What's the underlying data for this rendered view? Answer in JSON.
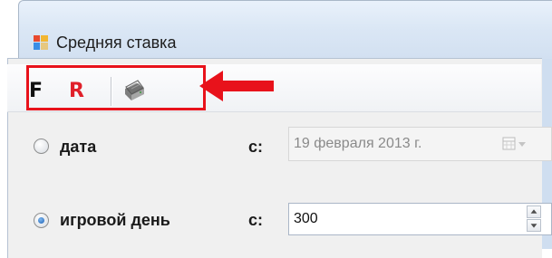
{
  "window": {
    "title": "Средняя ставка",
    "icon": "app-window-icon"
  },
  "toolbar": {
    "buttons": [
      {
        "label": "F",
        "color": "#111111"
      },
      {
        "label": "R",
        "color": "#e0202a"
      }
    ],
    "print_icon": "printer-icon"
  },
  "annotation": {
    "highlight_color": "#e8121b",
    "arrow": "red-arrow-pointing-left"
  },
  "options": {
    "date": {
      "label": "дата",
      "selected": false,
      "from_label": "с:",
      "value": "19 февраля  2013 г.",
      "enabled": false,
      "dropdown_icon": "calendar-dropdown-icon"
    },
    "game_day": {
      "label": "игровой день",
      "selected": true,
      "from_label": "с:",
      "value": "300",
      "spinner_icons": [
        "spin-up-icon",
        "spin-down-icon"
      ]
    }
  }
}
